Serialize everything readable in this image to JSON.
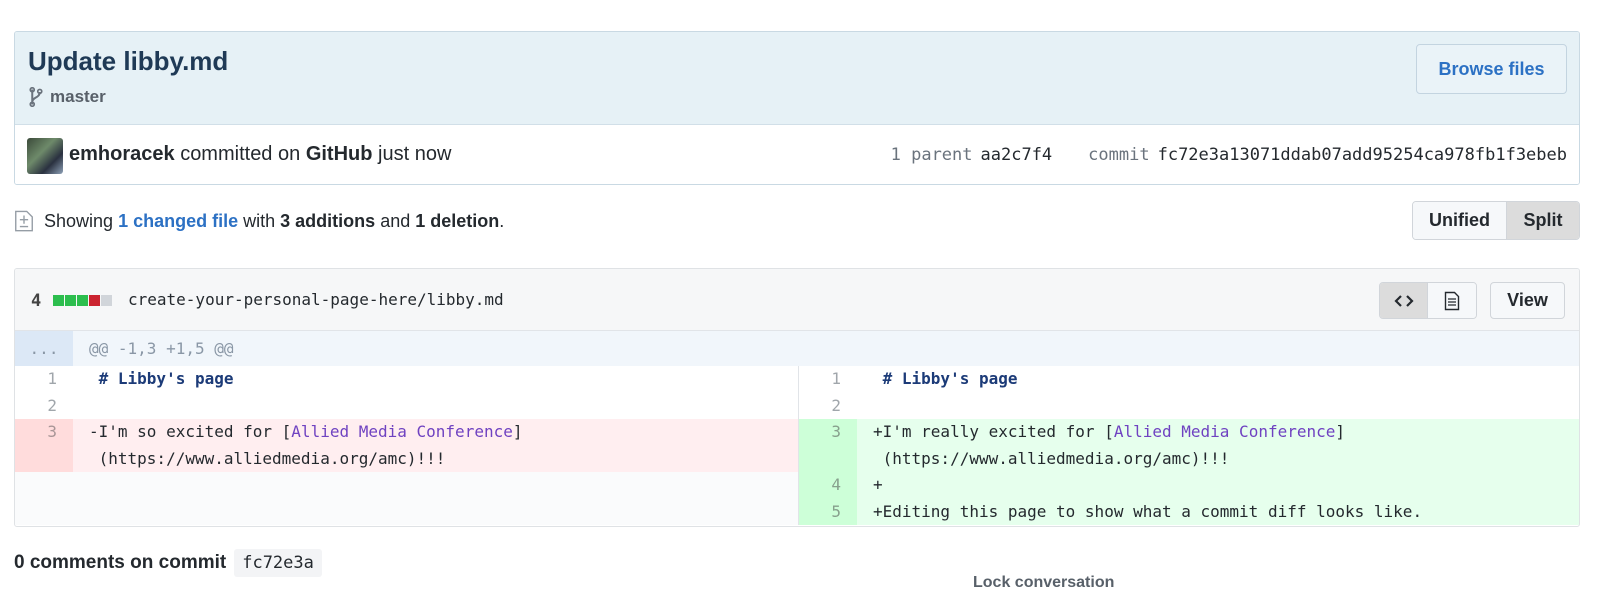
{
  "commit": {
    "title": "Update libby.md",
    "branch": "master",
    "browse_label": "Browse files",
    "author": "emhoracek",
    "committed_on": "committed on",
    "platform": "GitHub",
    "time": "just now",
    "parent_label": "1 parent",
    "parent_sha": "aa2c7f4",
    "commit_label": "commit",
    "commit_sha": "fc72e3a13071ddab07add95254ca978fb1f3ebeb"
  },
  "toc": {
    "showing": "Showing",
    "changed_files": "1 changed file",
    "with": "with",
    "additions": "3 additions",
    "and": "and",
    "deletions": "1 deletion",
    "period": "."
  },
  "view_mode": {
    "unified": "Unified",
    "split": "Split"
  },
  "file": {
    "change_count": "4",
    "stat_colors": [
      "#2cbe4e",
      "#2cbe4e",
      "#2cbe4e",
      "#cb2431",
      "#d1d5da"
    ],
    "path": "create-your-personal-page-here/libby.md",
    "view_label": "View",
    "hunk_dots": "...",
    "hunk_header": "@@ -1,3 +1,5 @@",
    "left": [
      {
        "num": "1",
        "text": " # Libby's page",
        "type": "ctx"
      },
      {
        "num": "2",
        "text": "",
        "type": "ctx"
      },
      {
        "num": "3",
        "text_a": "-I'm so excited for [",
        "link": "Allied Media Conference",
        "text_b": "]",
        "wrap": " (https://www.alliedmedia.org/amc)!!!",
        "type": "del"
      }
    ],
    "right": [
      {
        "num": "1",
        "text": " # Libby's page",
        "type": "ctx"
      },
      {
        "num": "2",
        "text": "",
        "type": "ctx"
      },
      {
        "num": "3",
        "text_a": "+I'm really excited for [",
        "link": "Allied Media Conference",
        "text_b": "]",
        "wrap": " (https://www.alliedmedia.org/amc)!!!",
        "type": "add"
      },
      {
        "num": "4",
        "text": "+",
        "type": "add"
      },
      {
        "num": "5",
        "text": "+Editing this page to show what a commit diff looks like.",
        "type": "add"
      }
    ]
  },
  "comments": {
    "title": "0 comments on commit",
    "sha": "fc72e3a",
    "lock": "Lock conversation"
  }
}
